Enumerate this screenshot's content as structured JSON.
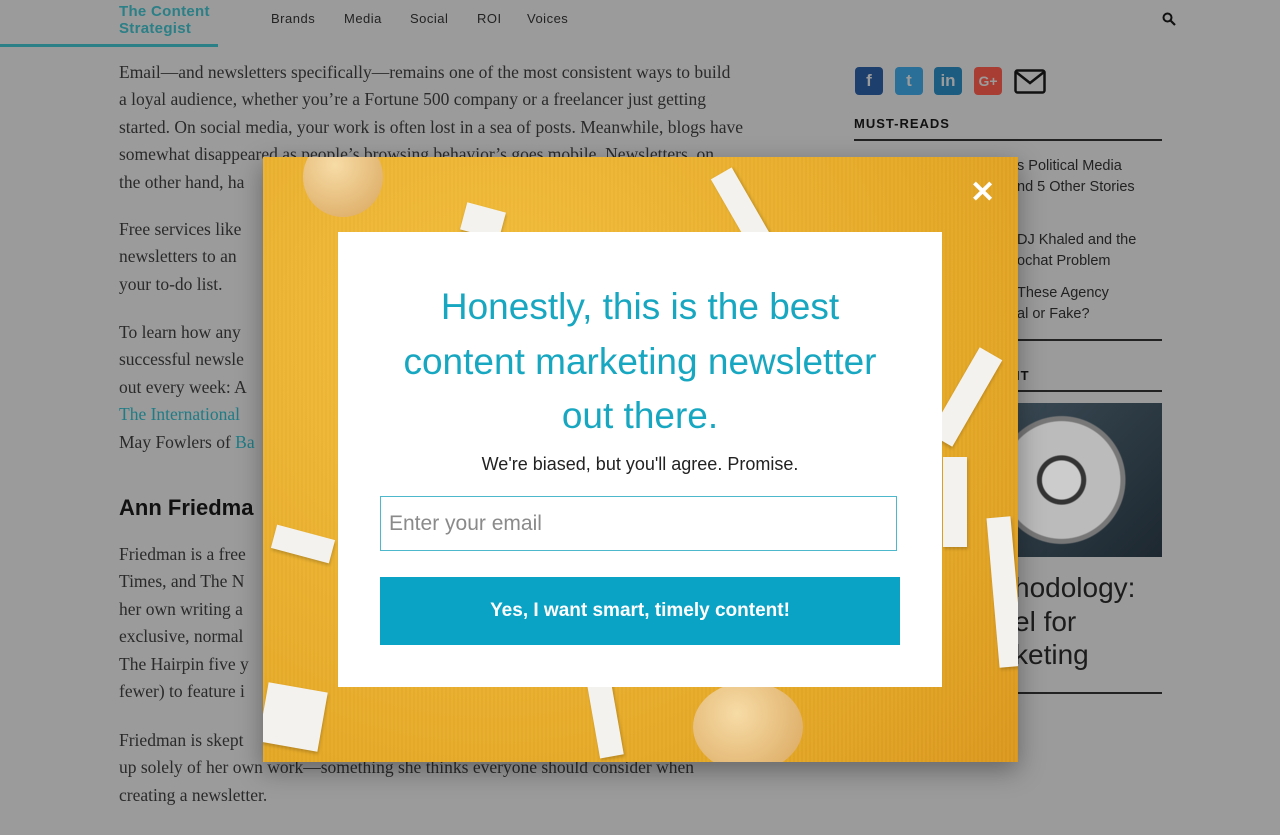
{
  "header": {
    "logo_line1": "The Content",
    "logo_line2": "Strategist",
    "nav": [
      "Brands",
      "Media",
      "Social",
      "ROI",
      "Voices"
    ],
    "search_icon": "search-icon"
  },
  "article": {
    "lines": [
      "Email—and newsletters specifically—remains one of the most consistent ways to build",
      "a loyal audience, whether you’re a Fortune 500 company or a freelancer just getting",
      "started. On social media, your work is often lost in a sea of posts. Meanwhile, blogs have",
      "somewhat disappeared as people’s browsing behavior’s goes mobile. Newsletters, on",
      "the other hand, ha"
    ],
    "p2": [
      "Free services like",
      "newsletters to an",
      "your to-do list."
    ],
    "p3": [
      "To learn how any",
      "successful newsle",
      "out every week: A"
    ],
    "p3_link": "The International",
    "p3_last_prefix": "May Fowlers of ",
    "p3_last_link": "Ba",
    "heading": "Ann Friedma",
    "p4": [
      "Friedman is a free",
      "Times, and The N",
      "her own writing a",
      "exclusive, normal",
      "The Hairpin five y",
      "fewer) to feature i"
    ],
    "p5": [
      "Friedman is skept",
      "up solely of her own work—something she thinks everyone should consider when",
      "creating a newsletter."
    ]
  },
  "sidebar": {
    "social_icons": [
      "facebook-icon",
      "twitter-icon",
      "linkedin-icon",
      "google-plus-icon",
      "email-icon"
    ],
    "must_reads_title": "MUST-READS",
    "must_reads": [
      [
        "s Political Media",
        "nd 5 Other Stories"
      ],
      [
        "DJ Khaled and the",
        "ochat Problem"
      ],
      [
        "These Agency",
        "al or Fake?"
      ]
    ],
    "section2_title": "IT",
    "feature_title": [
      "hodology:",
      "el for",
      "keting"
    ]
  },
  "modal": {
    "headline": [
      "Honestly, this is the best",
      "content marketing newsletter",
      "out there."
    ],
    "subtitle": "We're biased, but you'll agree. Promise.",
    "email_placeholder": "Enter your email",
    "email_value": "",
    "cta_label": "Yes, I want smart, timely content!",
    "close_icon": "close-icon",
    "accent": "#17a7c1",
    "button_color": "#0aa3c6"
  }
}
